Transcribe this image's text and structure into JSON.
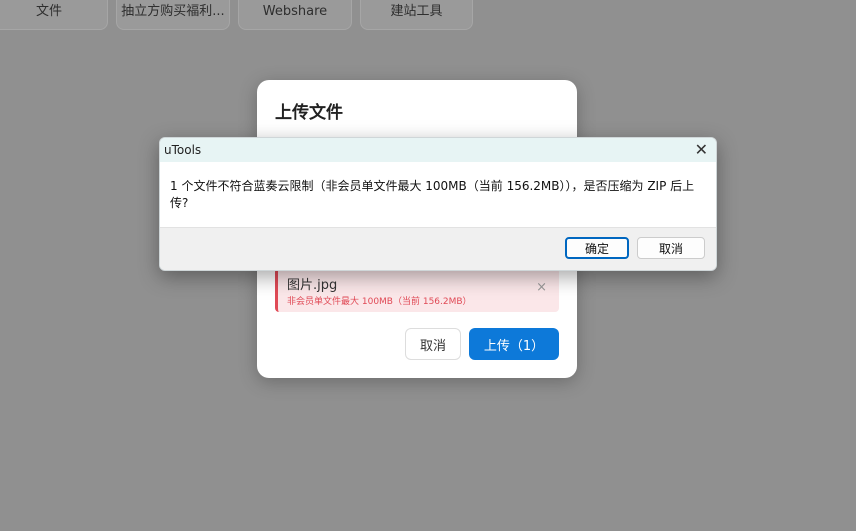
{
  "tabs": [
    {
      "label": "文件"
    },
    {
      "label": "抽立方购买福利..."
    },
    {
      "label": "Webshare"
    },
    {
      "label": "建站工具"
    }
  ],
  "upload_dialog": {
    "title": "上传文件",
    "file": {
      "name": "图片.jpg",
      "error": "非会员单文件最大 100MB（当前 156.2MB）",
      "remove_glyph": "×"
    },
    "cancel_label": "取消",
    "upload_label": "上传（1）"
  },
  "msgbox": {
    "title": "uTools",
    "close_glyph": "✕",
    "message": "1 个文件不符合蓝奏云限制（非会员单文件最大 100MB（当前 156.2MB）），是否压缩为 ZIP 后上传?",
    "ok_label": "确定",
    "cancel_label": "取消"
  }
}
